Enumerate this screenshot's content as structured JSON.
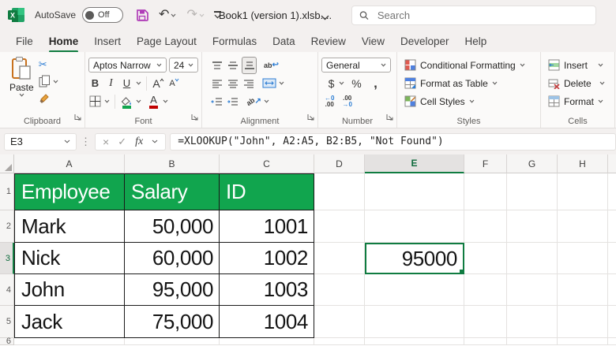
{
  "titlebar": {
    "autosave_label": "AutoSave",
    "autosave_state": "Off",
    "document_title": "Book1 (version 1).xlsb....",
    "search_placeholder": "Search"
  },
  "menubar": {
    "items": [
      "File",
      "Home",
      "Insert",
      "Page Layout",
      "Formulas",
      "Data",
      "Review",
      "View",
      "Developer",
      "Help"
    ],
    "active_item": "Home"
  },
  "ribbon": {
    "clipboard": {
      "group_label": "Clipboard",
      "paste_label": "Paste"
    },
    "font": {
      "group_label": "Font",
      "font_name": "Aptos Narrow",
      "font_size": "24",
      "bold": "B",
      "italic": "I",
      "underline": "U",
      "grow_letter": "A",
      "shrink_letter": "A",
      "font_color_letter": "A"
    },
    "alignment": {
      "group_label": "Alignment",
      "wrap_label": "ab",
      "orientation_label": "ab"
    },
    "number": {
      "group_label": "Number",
      "format": "General",
      "dollar": "$",
      "percent": "%",
      "comma": ",",
      "inc_top": "←0",
      "inc_bot": ".00",
      "dec_top": ".00",
      "dec_bot": "→0"
    },
    "styles": {
      "group_label": "Styles",
      "conditional_formatting": "Conditional Formatting",
      "format_as_table": "Format as Table",
      "cell_styles": "Cell Styles"
    },
    "cells": {
      "group_label": "Cells",
      "insert": "Insert",
      "delete": "Delete",
      "format": "Format"
    }
  },
  "formula_bar": {
    "cell_reference": "E3",
    "fx_label": "fx",
    "formula": "=XLOOKUP(\"John\", A2:A5, B2:B5, \"Not Found\")"
  },
  "sheet": {
    "col_headers": [
      "A",
      "B",
      "C",
      "D",
      "E",
      "F",
      "G",
      "H"
    ],
    "row_headers": [
      "1",
      "2",
      "3",
      "4",
      "5",
      "6"
    ],
    "selected_column": "E",
    "selected_row": "3",
    "selected_cell": "E3"
  },
  "cells": {
    "A1": "Employee",
    "B1": "Salary",
    "C1": "ID",
    "A2": "Mark",
    "B2": "50,000",
    "C2": "1001",
    "A3": "Nick",
    "B3": "60,000",
    "C3": "1002",
    "A4": "John",
    "B4": "95,000",
    "C4": "1003",
    "A5": "Jack",
    "B5": "75,000",
    "C5": "1004",
    "E3": "95000"
  },
  "icons": {
    "scissors": "✂",
    "undo": "↶",
    "redo": "↷",
    "dots": "⋮",
    "cancel": "×",
    "check": "✓",
    "return_arrow": "↩",
    "ne_arrow": "↗",
    "left_arrow": "←",
    "right_arrow": "→"
  },
  "colors": {
    "header_fill_green": "#11A54E",
    "selection_green": "#107C41",
    "active_tab_underline": "#107C41",
    "save_icon_purple": "#B03EB8",
    "titlebar_bg": "#F3F0EF",
    "table_border": "#1a1a1a",
    "gridline": "#E4E2E0"
  }
}
